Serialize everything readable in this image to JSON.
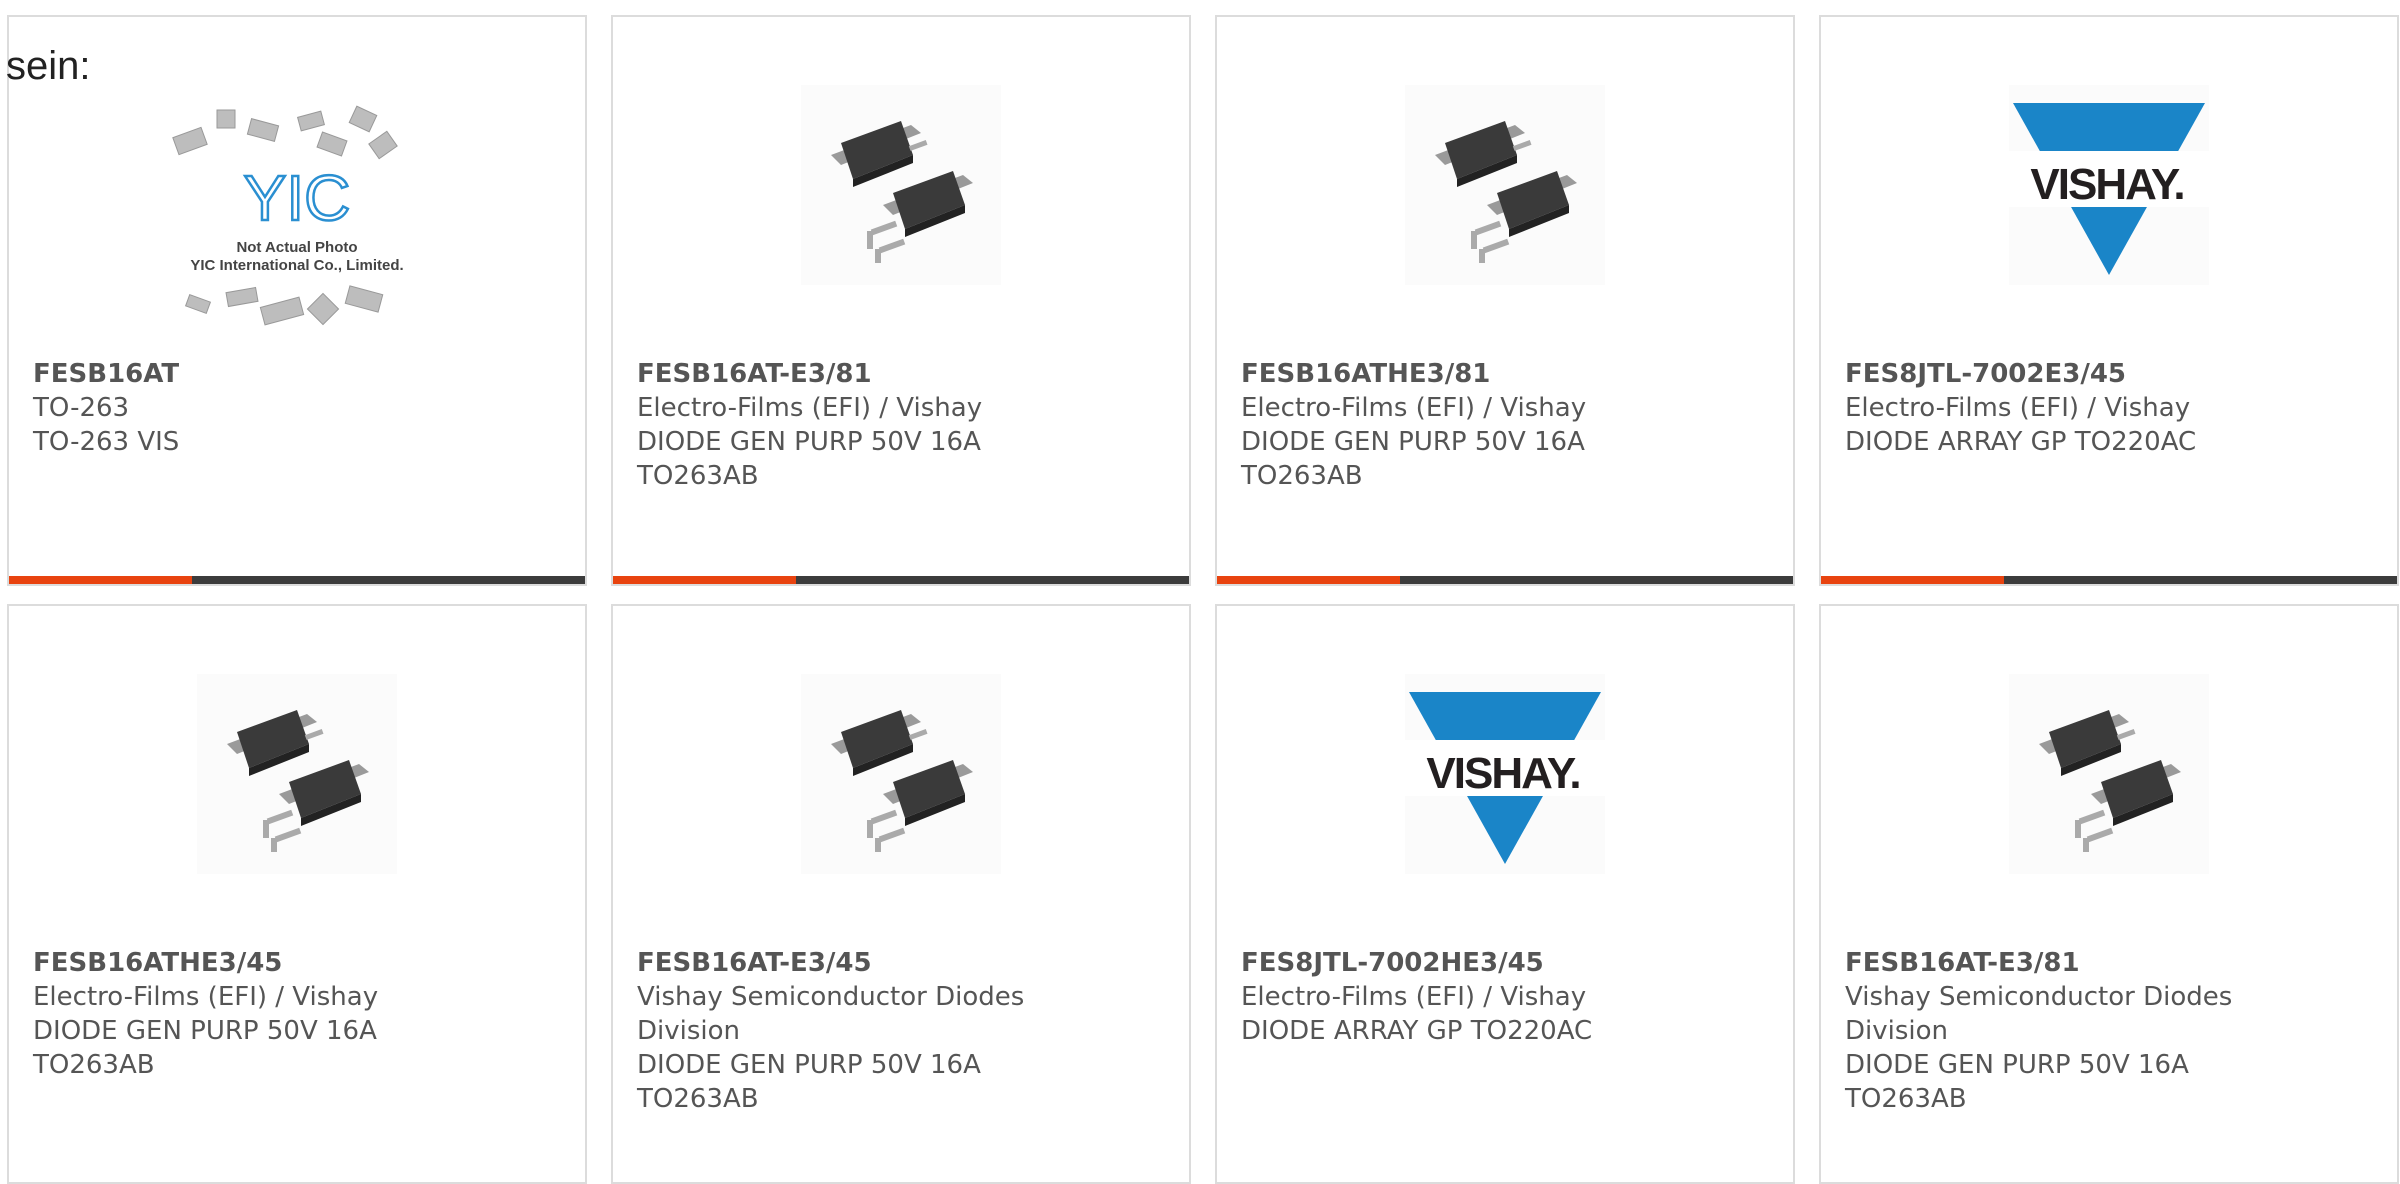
{
  "intro_text": "sein:",
  "colors": {
    "accent": "#e8430f",
    "bar": "#3c3c3c",
    "border": "#dcdcdc",
    "vishay_blue": "#1a85c8"
  },
  "yic_placeholder": {
    "line1": "Not Actual Photo",
    "line2": "YIC International Co., Limited.",
    "logo_text": "YIC"
  },
  "vishay_logo_text": "VISHAY.",
  "products": [
    {
      "part": "FESB16AT",
      "line1": "TO-263",
      "line2": "TO-263 VIS",
      "line3": "",
      "line4": "",
      "image": "yic-placeholder"
    },
    {
      "part": "FESB16AT-E3/81",
      "line1": "Electro-Films (EFI) / Vishay",
      "line2": "DIODE GEN PURP 50V 16A",
      "line3": "TO263AB",
      "line4": "",
      "image": "to263-package-icon"
    },
    {
      "part": "FESB16ATHE3/81",
      "line1": "Electro-Films (EFI) / Vishay",
      "line2": "DIODE GEN PURP 50V 16A",
      "line3": "TO263AB",
      "line4": "",
      "image": "to263-package-icon"
    },
    {
      "part": "FES8JTL-7002E3/45",
      "line1": "Electro-Films (EFI) / Vishay",
      "line2": "DIODE ARRAY GP TO220AC",
      "line3": "",
      "line4": "",
      "image": "vishay-logo"
    },
    {
      "part": "FESB16ATHE3/45",
      "line1": "Electro-Films (EFI) / Vishay",
      "line2": "DIODE GEN PURP 50V 16A",
      "line3": "TO263AB",
      "line4": "",
      "image": "to263-package-icon"
    },
    {
      "part": "FESB16AT-E3/45",
      "line1": "Vishay Semiconductor Diodes",
      "line2": "Division",
      "line3": "DIODE GEN PURP 50V 16A",
      "line4": "TO263AB",
      "image": "to263-package-icon"
    },
    {
      "part": "FES8JTL-7002HE3/45",
      "line1": "Electro-Films (EFI) / Vishay",
      "line2": "DIODE ARRAY GP TO220AC",
      "line3": "",
      "line4": "",
      "image": "vishay-logo"
    },
    {
      "part": "FESB16AT-E3/81",
      "line1": "Vishay Semiconductor Diodes",
      "line2": "Division",
      "line3": "DIODE GEN PURP 50V 16A",
      "line4": "TO263AB",
      "image": "to263-package-icon"
    }
  ]
}
